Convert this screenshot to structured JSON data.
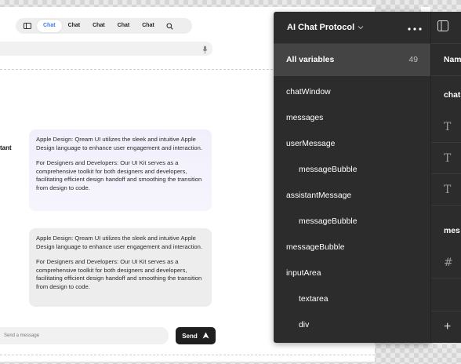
{
  "toolbar": {
    "tabs": [
      {
        "label": "Chat",
        "active": true
      },
      {
        "label": "Chat"
      },
      {
        "label": "Chat"
      },
      {
        "label": "Chat"
      },
      {
        "label": "Chat"
      }
    ]
  },
  "chat": {
    "sender_label": "tant",
    "bubble_1": {
      "p1": "Apple Design: Qream UI utilizes the sleek and intuitive Apple Design language to enhance user engagement and interaction.",
      "p2": "For Designers and Developers: Our UI Kit serves as a comprehensive toolkit for both designers and developers, facilitating efficient design handoff and smoothing the transition from design to code."
    },
    "bubble_2": {
      "p1": "Apple Design: Qream UI utilizes the sleek and intuitive Apple Design language to enhance user engagement and interaction.",
      "p2": "For Designers and Developers: Our UI Kit serves as a comprehensive toolkit for both designers and developers, facilitating efficient design handoff and smoothing the transition from design to code."
    },
    "input_placeholder": "Send a message",
    "send_label": "Send"
  },
  "panel": {
    "title": "AI Chat Protocol",
    "all_variables_label": "All variables",
    "all_variables_count": "49",
    "items": [
      {
        "label": "chatWindow"
      },
      {
        "label": "messages"
      },
      {
        "label": "userMessage"
      },
      {
        "label": "messageBubble"
      },
      {
        "label": "assistantMessage"
      },
      {
        "label": "messageBubble"
      },
      {
        "label": "messageBubble"
      },
      {
        "label": "inputArea"
      },
      {
        "label": "textarea"
      },
      {
        "label": "div"
      }
    ]
  },
  "side": {
    "header": "Nam",
    "group_1": "chat",
    "group_2": "mes",
    "type_icons": [
      "T",
      "T",
      "T",
      "#"
    ]
  },
  "colors": {
    "accent": "#3b7be8",
    "panel_bg": "#2c2c2c",
    "panel_active": "#444444",
    "send_button": "#1f1f1f"
  }
}
